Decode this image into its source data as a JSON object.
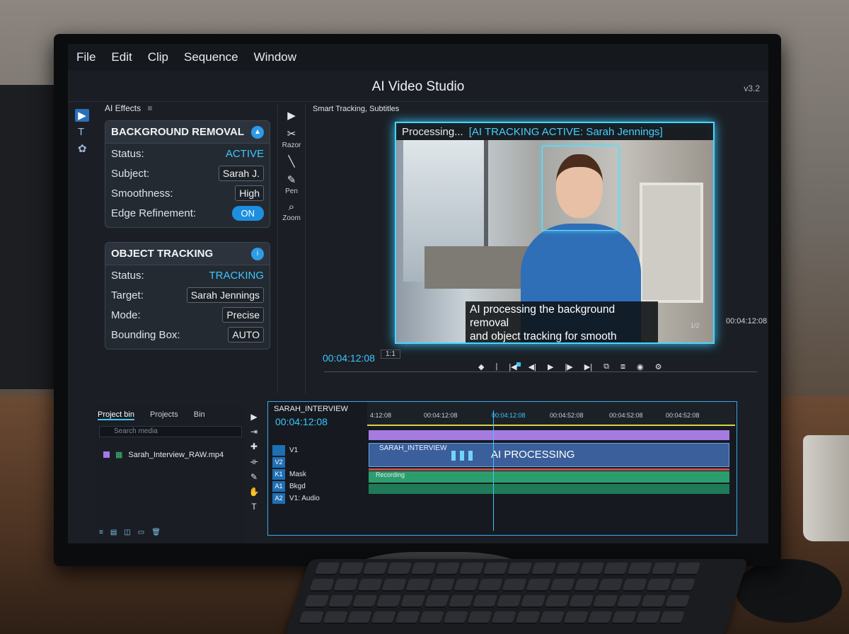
{
  "menu": [
    "File",
    "Edit",
    "Clip",
    "Sequence",
    "Window"
  ],
  "app": {
    "title": "AI Video Studio",
    "version": "v3.2"
  },
  "left_tools": [
    "select-icon",
    "type-icon",
    "effects-icon"
  ],
  "effects_panel": {
    "title": "AI Effects",
    "background_removal": {
      "title": "BACKGROUND REMOVAL",
      "status_label": "Status:",
      "status_value": "ACTIVE",
      "subject_label": "Subject:",
      "subject_value": "Sarah J.",
      "smoothness_label": "Smoothness:",
      "smoothness_value": "High",
      "edge_label": "Edge Refinement:",
      "edge_value": "ON"
    },
    "object_tracking": {
      "title": "OBJECT TRACKING",
      "status_label": "Status:",
      "status_value": "TRACKING",
      "target_label": "Target:",
      "target_value": "Sarah Jennings",
      "mode_label": "Mode:",
      "mode_value": "Precise",
      "bbox_label": "Bounding Box:",
      "bbox_value": "AUTO"
    }
  },
  "mid_tools": {
    "razor": "Razor",
    "pen": "Pen",
    "zoom": "Zoom"
  },
  "monitor": {
    "caption": "Smart Tracking, Subtitles",
    "processing": "Processing...",
    "tracking_text": "[AI TRACKING ACTIVE: Sarah Jennings]",
    "subtitle_line1": "AI processing the background removal",
    "subtitle_line2": "and object tracking for smooth editing.",
    "viewer_timecode": "00:04:12:08",
    "fit": "1/2",
    "timecode": "00:04:12:08",
    "zoom_select": "1:1"
  },
  "project_bin": {
    "tabs": [
      "Project bin",
      "Projects",
      "Bin"
    ],
    "search_placeholder": "Search media",
    "item": "Sarah_Interview_RAW.mp4"
  },
  "timeline": {
    "sequence_name": "SARAH_INTERVIEW",
    "timecode": "00:04:12:08",
    "ruler": [
      "4:12:08",
      "00:04:12:08",
      "00:04:12:08",
      "00:04:52:08",
      "00:04:52:08",
      "00:04:52:08"
    ],
    "tracks": {
      "v1": "V1",
      "v2": "V2",
      "mask": "Mask",
      "bkgd": "Bkgd",
      "audio": "V1: Audio",
      "k1": "K1",
      "a1": "A1",
      "a2": "A2"
    },
    "clip_label": "SARAH_INTERVIEW",
    "processing_label": "AI PROCESSING",
    "recording_label": "Recording"
  }
}
